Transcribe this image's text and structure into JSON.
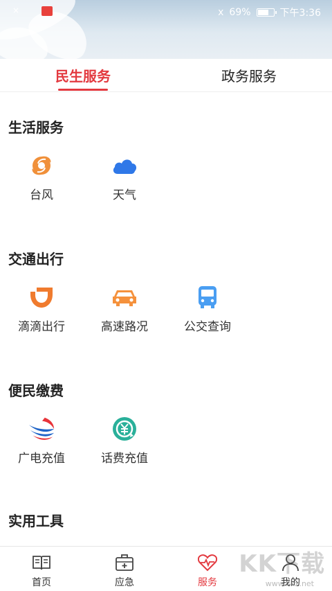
{
  "status_bar": {
    "left_text": "×",
    "signal": "ⅹ",
    "battery_percent": "69%",
    "battery_level": 0.69,
    "time": "下午3:36"
  },
  "tabs": [
    {
      "label": "民生服务",
      "active": true
    },
    {
      "label": "政务服务",
      "active": false
    }
  ],
  "sections": [
    {
      "title": "生活服务",
      "items": [
        {
          "label": "台风",
          "icon": "typhoon-icon"
        },
        {
          "label": "天气",
          "icon": "cloud-icon"
        }
      ]
    },
    {
      "title": "交通出行",
      "items": [
        {
          "label": "滴滴出行",
          "icon": "didi-icon"
        },
        {
          "label": "高速路况",
          "icon": "car-icon"
        },
        {
          "label": "公交查询",
          "icon": "bus-icon"
        }
      ]
    },
    {
      "title": "便民缴费",
      "items": [
        {
          "label": "广电充值",
          "icon": "broadcast-logo-icon"
        },
        {
          "label": "话费充值",
          "icon": "yuan-recharge-icon"
        }
      ]
    },
    {
      "title": "实用工具",
      "items": []
    }
  ],
  "bottom_nav": [
    {
      "label": "首页",
      "icon": "book-icon",
      "active": false
    },
    {
      "label": "应急",
      "icon": "first-aid-kit-icon",
      "active": false
    },
    {
      "label": "服务",
      "icon": "heart-pulse-icon",
      "active": true
    },
    {
      "label": "我的",
      "icon": "user-icon",
      "active": false
    }
  ],
  "colors": {
    "accent": "#e3393f",
    "typhoon": "#f0903a",
    "weather": "#2f78e8",
    "didi": "#f07b2e",
    "car": "#f5913c",
    "bus": "#4a9ef2",
    "recharge": "#2ab09a"
  },
  "watermark": {
    "text": "KK下载",
    "sub": "www.kkx.net"
  }
}
